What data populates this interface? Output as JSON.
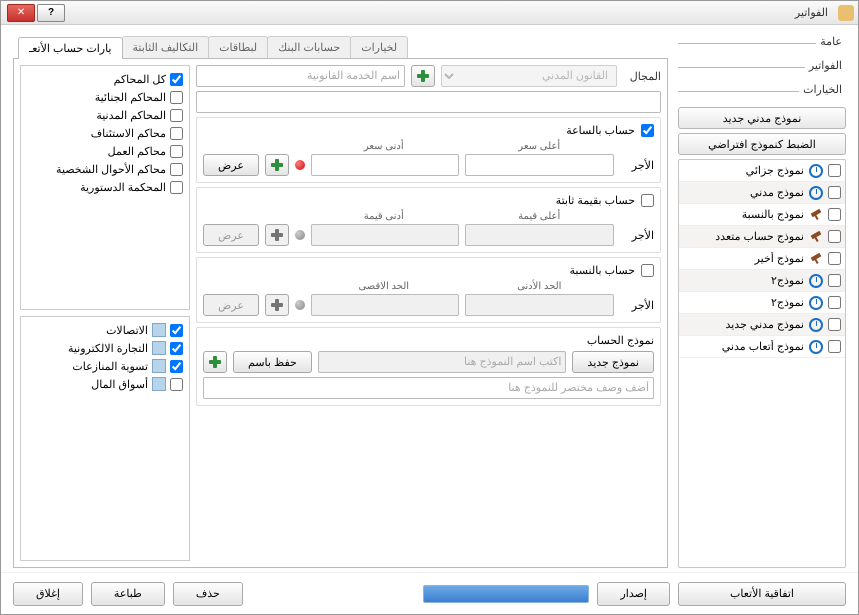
{
  "window": {
    "title": "الفواتير"
  },
  "sidebar": {
    "sections": {
      "general": "عامة",
      "invoices": "الفواتير",
      "options": "الخيارات"
    },
    "newBtn": "نموذج مدني جديد",
    "defaultBtn": "الضبط كنموذج افتراضي",
    "items": [
      {
        "label": "نموذج جزائي",
        "icon": "clock"
      },
      {
        "label": "نموذج مدني",
        "icon": "clock"
      },
      {
        "label": "نموذج بالنسبة",
        "icon": "hammer"
      },
      {
        "label": "نموذج حساب متعدد",
        "icon": "hammer"
      },
      {
        "label": "نموذج أخير",
        "icon": "hammer"
      },
      {
        "label": "نموذج٢",
        "icon": "clock"
      },
      {
        "label": "نموذج٢",
        "icon": "clock"
      },
      {
        "label": "نموذج مدني جديد",
        "icon": "clock"
      },
      {
        "label": "نموذج أتعاب مدني",
        "icon": "clock"
      }
    ],
    "agreementBtn": "اتفاقية الأتعاب"
  },
  "tabs": [
    "يارات حساب الأتعـ",
    "التكاليف الثابتة",
    "لبطاقات",
    "حسابات البنك",
    "لخيارات"
  ],
  "courts": [
    {
      "label": "كل المحاكم",
      "checked": true
    },
    {
      "label": "المحاكم الجنائية",
      "checked": false
    },
    {
      "label": "المحاكم المدنية",
      "checked": false
    },
    {
      "label": "محاكم الاستئناف",
      "checked": false
    },
    {
      "label": "محاكم العمل",
      "checked": false
    },
    {
      "label": "محاكم الأحوال الشخصية",
      "checked": false
    },
    {
      "label": "المحكمة الدستورية",
      "checked": false
    }
  ],
  "categories": [
    {
      "label": "الاتصالات",
      "checked": true
    },
    {
      "label": "التجارة الالكترونية",
      "checked": true
    },
    {
      "label": "تسوية المنازعات",
      "checked": true
    },
    {
      "label": "أسواق المال",
      "checked": false
    }
  ],
  "form": {
    "fieldLabel": "المجال",
    "fieldSelect": "القانون المدني",
    "servicePlaceholder": "اسم الخدمة القانونية",
    "hourly": {
      "title": "حساب بالساعة",
      "checked": true,
      "maxLabel": "أعلى سعر",
      "minLabel": "أدنى سعر",
      "wageLabel": "الأجر",
      "viewBtn": "عرض"
    },
    "fixed": {
      "title": "حساب بقيمة ثابتة",
      "checked": false,
      "maxLabel": "أعلى قيمة",
      "minLabel": "أدنى قيمة",
      "wageLabel": "الأجر",
      "viewBtn": "عرض"
    },
    "percent": {
      "title": "حساب بالنسبة",
      "checked": false,
      "minLabel": "الحد الأدنى",
      "maxLabel": "الحد الاقصى",
      "wageLabel": "الأجر",
      "viewBtn": "عرض"
    },
    "model": {
      "title": "نموذج الحساب",
      "newBtn": "نموذج جديد",
      "saveBtn": "حفظ باسم",
      "namePlaceholder": "اكتب اسم النموذج هنا",
      "descPlaceholder": "أضف وصف مختصر للنموذج هنا"
    }
  },
  "footer": {
    "issue": "إصدار",
    "delete": "حذف",
    "print": "طباعة",
    "close": "إغلاق"
  }
}
